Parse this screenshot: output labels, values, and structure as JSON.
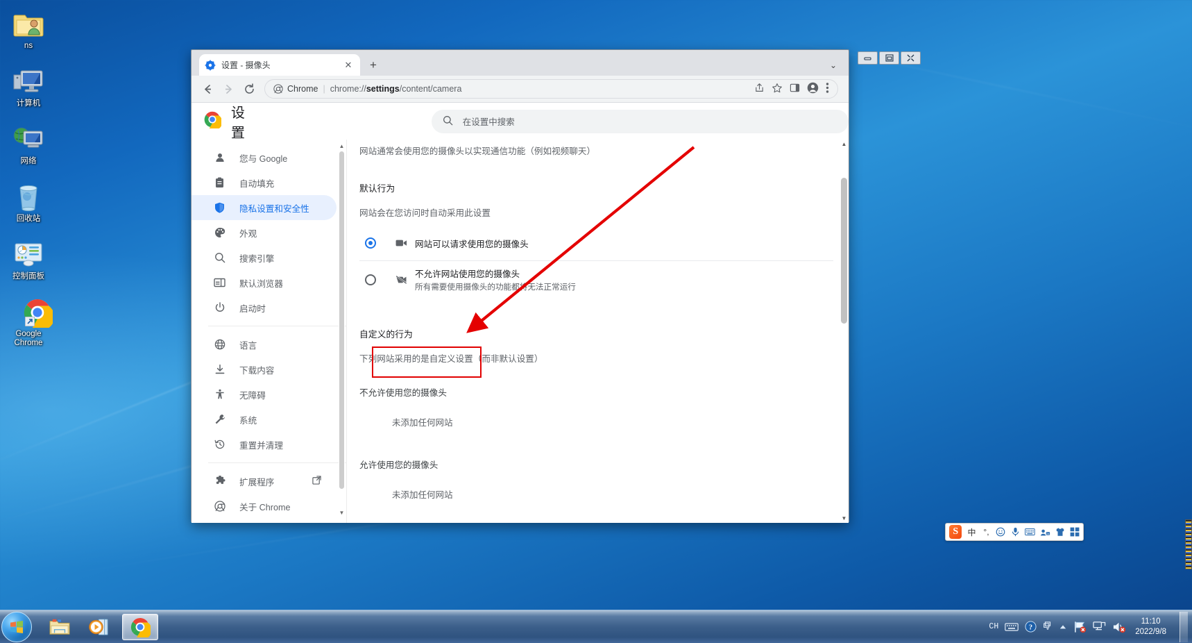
{
  "desktop": {
    "icons": [
      {
        "label": "ns",
        "icon": "user-folder-icon"
      },
      {
        "label": "计算机",
        "icon": "computer-icon"
      },
      {
        "label": "网络",
        "icon": "network-icon"
      },
      {
        "label": "回收站",
        "icon": "recycle-bin-icon"
      },
      {
        "label": "控制面板",
        "icon": "control-panel-icon"
      },
      {
        "label": "Google Chrome",
        "icon": "chrome-shortcut-icon"
      }
    ]
  },
  "window": {
    "controls": {
      "minimize": "—",
      "maximize": "❐",
      "close": "✕"
    }
  },
  "browser": {
    "tab": {
      "title": "设置 - 摄像头",
      "favicon": "settings-gear-icon",
      "close": "✕"
    },
    "new_tab_label": "+",
    "tab_list_chevron": "⌄",
    "nav": {
      "back": "←",
      "forward": "→",
      "reload": "⟳"
    },
    "omnibox": {
      "chip_label": "Chrome",
      "separator": "|",
      "url_prefix": "chrome://",
      "url_bold": "settings",
      "url_suffix": "/content/camera",
      "share_icon": "share-icon",
      "bookmark_icon": "star-icon",
      "sidepanel_icon": "side-panel-icon",
      "profile_icon": "profile-avatar-icon",
      "menu_icon": "three-dot-menu-icon"
    }
  },
  "settings": {
    "title": "设置",
    "logo": "chrome-logo-icon",
    "search_placeholder": "在设置中搜索",
    "search_icon": "search-icon",
    "sidebar": {
      "group1": [
        {
          "label": "您与 Google",
          "icon": "person-icon",
          "active": false
        },
        {
          "label": "自动填充",
          "icon": "clipboard-icon",
          "active": false
        },
        {
          "label": "隐私设置和安全性",
          "icon": "shield-icon",
          "active": true
        },
        {
          "label": "外观",
          "icon": "palette-icon",
          "active": false
        },
        {
          "label": "搜索引擎",
          "icon": "search-icon",
          "active": false
        },
        {
          "label": "默认浏览器",
          "icon": "browser-window-icon",
          "active": false
        },
        {
          "label": "启动时",
          "icon": "power-icon",
          "active": false
        }
      ],
      "group2": [
        {
          "label": "语言",
          "icon": "globe-icon",
          "active": false
        },
        {
          "label": "下载内容",
          "icon": "download-icon",
          "active": false
        },
        {
          "label": "无障碍",
          "icon": "accessibility-icon",
          "active": false
        },
        {
          "label": "系统",
          "icon": "wrench-icon",
          "active": false
        },
        {
          "label": "重置并清理",
          "icon": "history-restore-icon",
          "active": false
        }
      ],
      "group3": [
        {
          "label": "扩展程序",
          "icon": "puzzle-icon",
          "external": "external-link-icon",
          "active": false
        },
        {
          "label": "关于 Chrome",
          "icon": "chrome-circle-icon",
          "active": false
        }
      ]
    },
    "content": {
      "description": "网站通常会使用您的摄像头以实现通信功能（例如视频聊天）",
      "default_behavior_heading": "默认行为",
      "default_behavior_sub": "网站会在您访问时自动采用此设置",
      "options": [
        {
          "label": "网站可以请求使用您的摄像头",
          "sub": "",
          "icon": "camera-icon",
          "selected": true
        },
        {
          "label": "不允许网站使用您的摄像头",
          "sub": "所有需要使用摄像头的功能都将无法正常运行",
          "icon": "camera-off-icon",
          "selected": false
        }
      ],
      "custom_heading": "自定义的行为",
      "custom_sub": "下列网站采用的是自定义设置（而非默认设置）",
      "block_group_label": "不允许使用您的摄像头",
      "block_empty": "未添加任何网站",
      "allow_group_label": "允许使用您的摄像头",
      "allow_empty": "未添加任何网站"
    }
  },
  "annotation": {
    "highlight_color": "#e10000",
    "arrow_color": "#e40000",
    "target_label": "不允许使用您的摄像头"
  },
  "ime": {
    "name": "sogou-input-toolbar",
    "logo_text": "S",
    "items": [
      {
        "icon": "chinese-mode-icon",
        "glyph": "中"
      },
      {
        "icon": "punctuation-icon",
        "glyph": "°,"
      },
      {
        "icon": "emoji-icon",
        "glyph": "☺"
      },
      {
        "icon": "voice-input-icon",
        "glyph": "🎤"
      },
      {
        "icon": "soft-keyboard-icon",
        "glyph": "⌨"
      },
      {
        "icon": "user-avatar-icon",
        "glyph": "👤"
      },
      {
        "icon": "skin-theme-icon",
        "glyph": "👕"
      },
      {
        "icon": "toolbox-icon",
        "glyph": "▦"
      }
    ]
  },
  "taskbar": {
    "start_icon": "windows-start-orb-icon",
    "pinned": [
      {
        "icon": "file-explorer-icon",
        "active": false
      },
      {
        "icon": "media-player-icon",
        "active": false
      },
      {
        "icon": "chrome-taskbar-icon",
        "active": true
      }
    ],
    "tray": {
      "lang": "CH",
      "keyboard_icon": "keyboard-icon",
      "help_icon": "help-icon",
      "window-switch_icon": "window-switch-icon",
      "show_hidden_icon": "show-hidden-icons-icon",
      "flag_icon": "action-center-flag-icon",
      "network_icon": "network-status-icon",
      "volume_icon": "volume-muted-icon",
      "time": "11:10",
      "date": "2022/9/8"
    }
  }
}
